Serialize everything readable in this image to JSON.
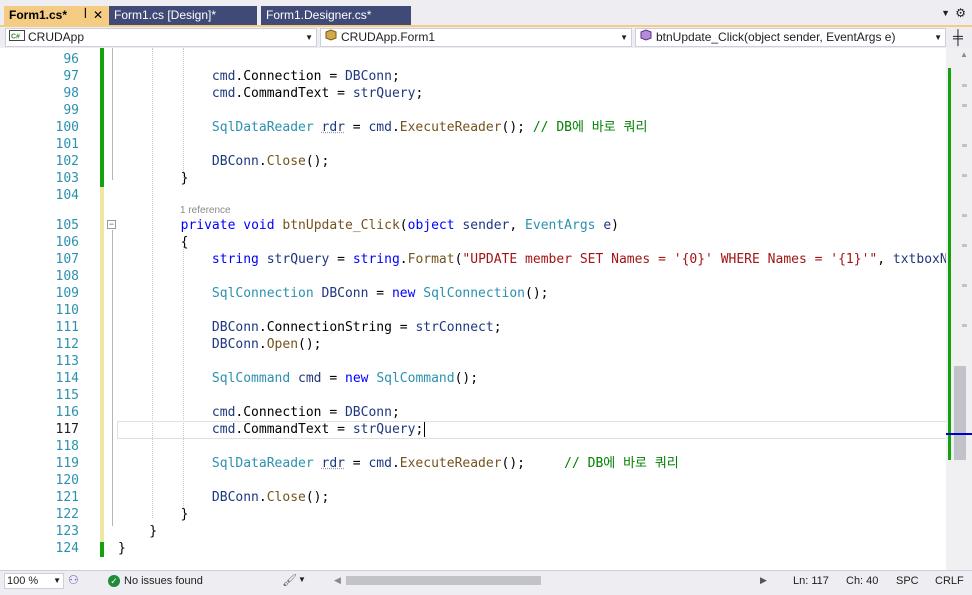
{
  "tabs": [
    {
      "label": "Form1.cs*",
      "active": true,
      "pin_icon": "pin-icon",
      "close_icon": "close-icon"
    },
    {
      "label": "Form1.cs [Design]*",
      "active": false
    },
    {
      "label": "Form1.Designer.cs*",
      "active": false
    }
  ],
  "navbar": {
    "project": "CRUDApp",
    "project_icon": "csharp-project-icon",
    "type": "CRUDApp.Form1",
    "type_icon": "class-icon",
    "member": "btnUpdate_Click(object sender, EventArgs e)",
    "member_icon": "method-icon"
  },
  "editor": {
    "line_numbers": [
      "96",
      "97",
      "98",
      "99",
      "100",
      "101",
      "102",
      "103",
      "104",
      "105",
      "106",
      "107",
      "108",
      "109",
      "110",
      "111",
      "112",
      "113",
      "114",
      "115",
      "116",
      "117",
      "118",
      "119",
      "120",
      "121",
      "122",
      "123",
      "124"
    ],
    "current_line_number": "117",
    "codelens": "1 reference",
    "comment_korean": "// DB에 바로 쿼리",
    "string_literal": "\"UPDATE member SET Names = '{0}' WHERE Names = '{1}'\"",
    "truncated_arg": "txtboxNewN"
  },
  "statusbar": {
    "zoom": "100 %",
    "issues": "No issues found",
    "line": "Ln: 117",
    "col": "Ch: 40",
    "spacing": "SPC",
    "line_ending": "CRLF"
  },
  "colors": {
    "active_tab": "#f5cc84",
    "inactive_tab": "#3f4a77",
    "keyword": "#0000ff",
    "type": "#2b91af",
    "string": "#a31515",
    "comment": "#008000",
    "change_saved": "#13a10e",
    "change_unsaved": "#efe7a1"
  }
}
